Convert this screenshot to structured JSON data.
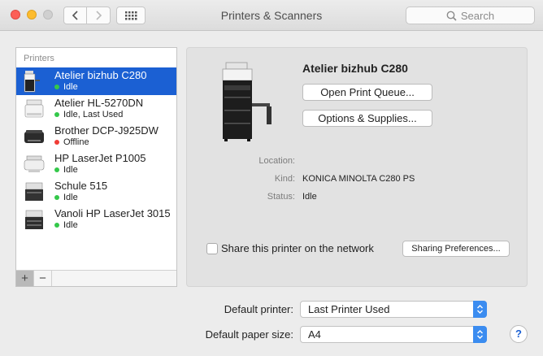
{
  "window": {
    "title": "Printers & Scanners"
  },
  "toolbar": {
    "back_icon": "chevron-left-icon",
    "forward_icon": "chevron-right-icon",
    "grid_icon": "grid-icon",
    "search_placeholder": "Search"
  },
  "sidebar": {
    "header": "Printers",
    "items": [
      {
        "name": "Atelier bizhub C280",
        "status": "Idle",
        "status_color": "#34c84a",
        "selected": true
      },
      {
        "name": "Atelier HL-5270DN",
        "status": "Idle, Last Used",
        "status_color": "#34c84a"
      },
      {
        "name": "Brother DCP-J925DW",
        "status": "Offline",
        "status_color": "#f03c36"
      },
      {
        "name": "HP LaserJet P1005",
        "status": "Idle",
        "status_color": "#34c84a"
      },
      {
        "name": "Schule 515",
        "status": "Idle",
        "status_color": "#34c84a"
      },
      {
        "name": "Vanoli HP LaserJet 3015",
        "status": "Idle",
        "status_color": "#34c84a"
      }
    ],
    "add_label": "+",
    "remove_label": "−"
  },
  "detail": {
    "printer_name": "Atelier bizhub C280",
    "open_queue_label": "Open Print Queue...",
    "options_label": "Options & Supplies...",
    "location_label": "Location:",
    "location_value": "",
    "kind_label": "Kind:",
    "kind_value": "KONICA MINOLTA C280 PS",
    "status_label": "Status:",
    "status_value": "Idle",
    "share_label": "Share this printer on the network",
    "share_checked": false,
    "sharing_prefs_label": "Sharing Preferences..."
  },
  "defaults": {
    "printer_label": "Default printer:",
    "printer_value": "Last Printer Used",
    "paper_label": "Default paper size:",
    "paper_value": "A4"
  },
  "help_label": "?",
  "colors": {
    "selection": "#1b60d3",
    "accent": "#3b8cf0"
  }
}
